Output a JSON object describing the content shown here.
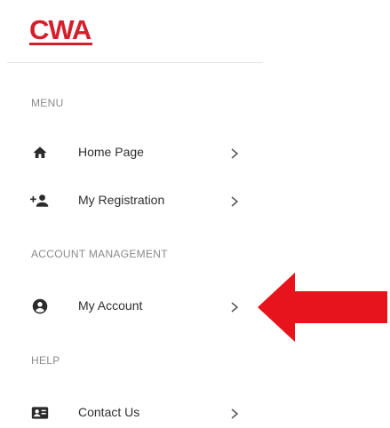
{
  "logo": {
    "text": "CWA"
  },
  "sections": [
    {
      "heading": "MENU"
    },
    {
      "heading": "ACCOUNT MANAGEMENT"
    },
    {
      "heading": "HELP"
    }
  ],
  "menu": {
    "home": {
      "label": "Home Page",
      "icon": "home-icon"
    },
    "registration": {
      "label": "My Registration",
      "icon": "add-person-icon"
    },
    "account": {
      "label": "My Account",
      "icon": "account-circle-icon"
    },
    "contact": {
      "label": "Contact Us",
      "icon": "contact-card-icon"
    }
  },
  "colors": {
    "brand": "#d51f2b",
    "annotation_arrow": "#e8141b",
    "heading": "#8a8a8a",
    "text": "#2f2f2f"
  }
}
